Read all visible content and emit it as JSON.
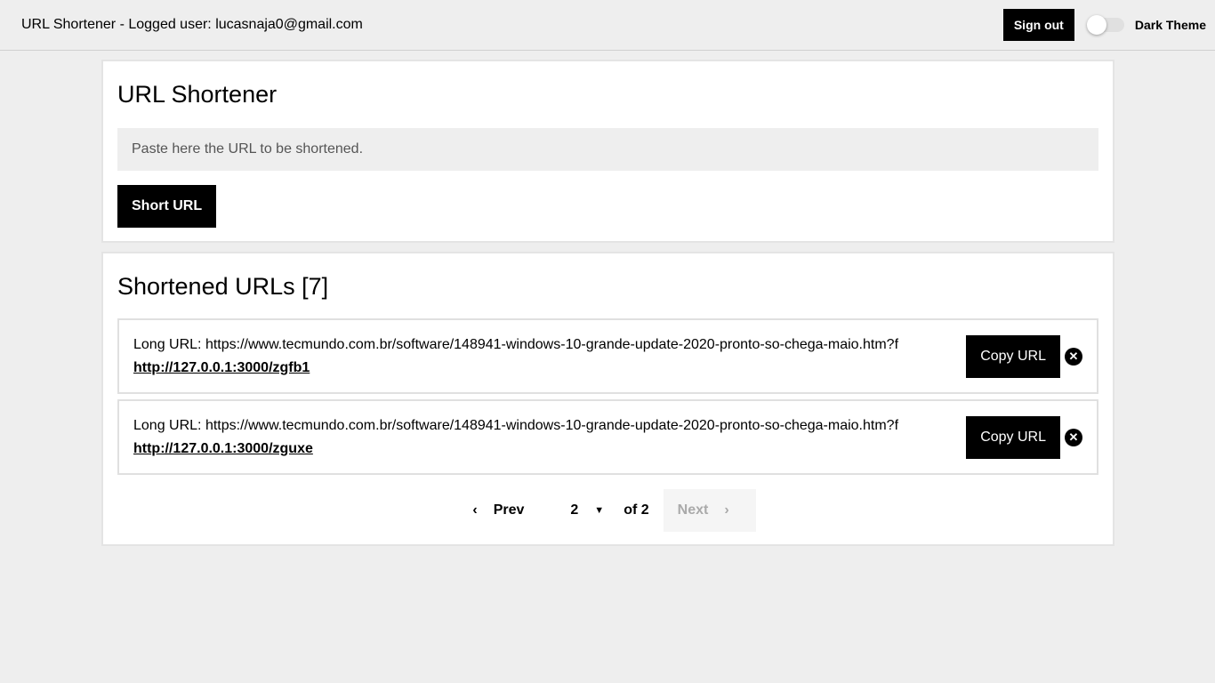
{
  "header": {
    "title": "URL Shortener - Logged user: lucasnaja0@gmail.com",
    "sign_out": "Sign out",
    "dark_theme": "Dark Theme",
    "dark_theme_on": false
  },
  "shortener": {
    "title": "URL Shortener",
    "placeholder": "Paste here the URL to be shortened.",
    "button": "Short URL"
  },
  "list": {
    "title": "Shortened URLs [7]",
    "copy_label": "Copy URL",
    "items": [
      {
        "long": "Long URL: https://www.tecmundo.com.br/software/148941-windows-10-grande-update-2020-pronto-so-chega-maio.htm?f",
        "short": "http://127.0.0.1:3000/zgfb1"
      },
      {
        "long": "Long URL: https://www.tecmundo.com.br/software/148941-windows-10-grande-update-2020-pronto-so-chega-maio.htm?f",
        "short": "http://127.0.0.1:3000/zguxe"
      }
    ]
  },
  "pagination": {
    "prev": "Prev",
    "page": "2",
    "of": "of 2",
    "next": "Next"
  }
}
